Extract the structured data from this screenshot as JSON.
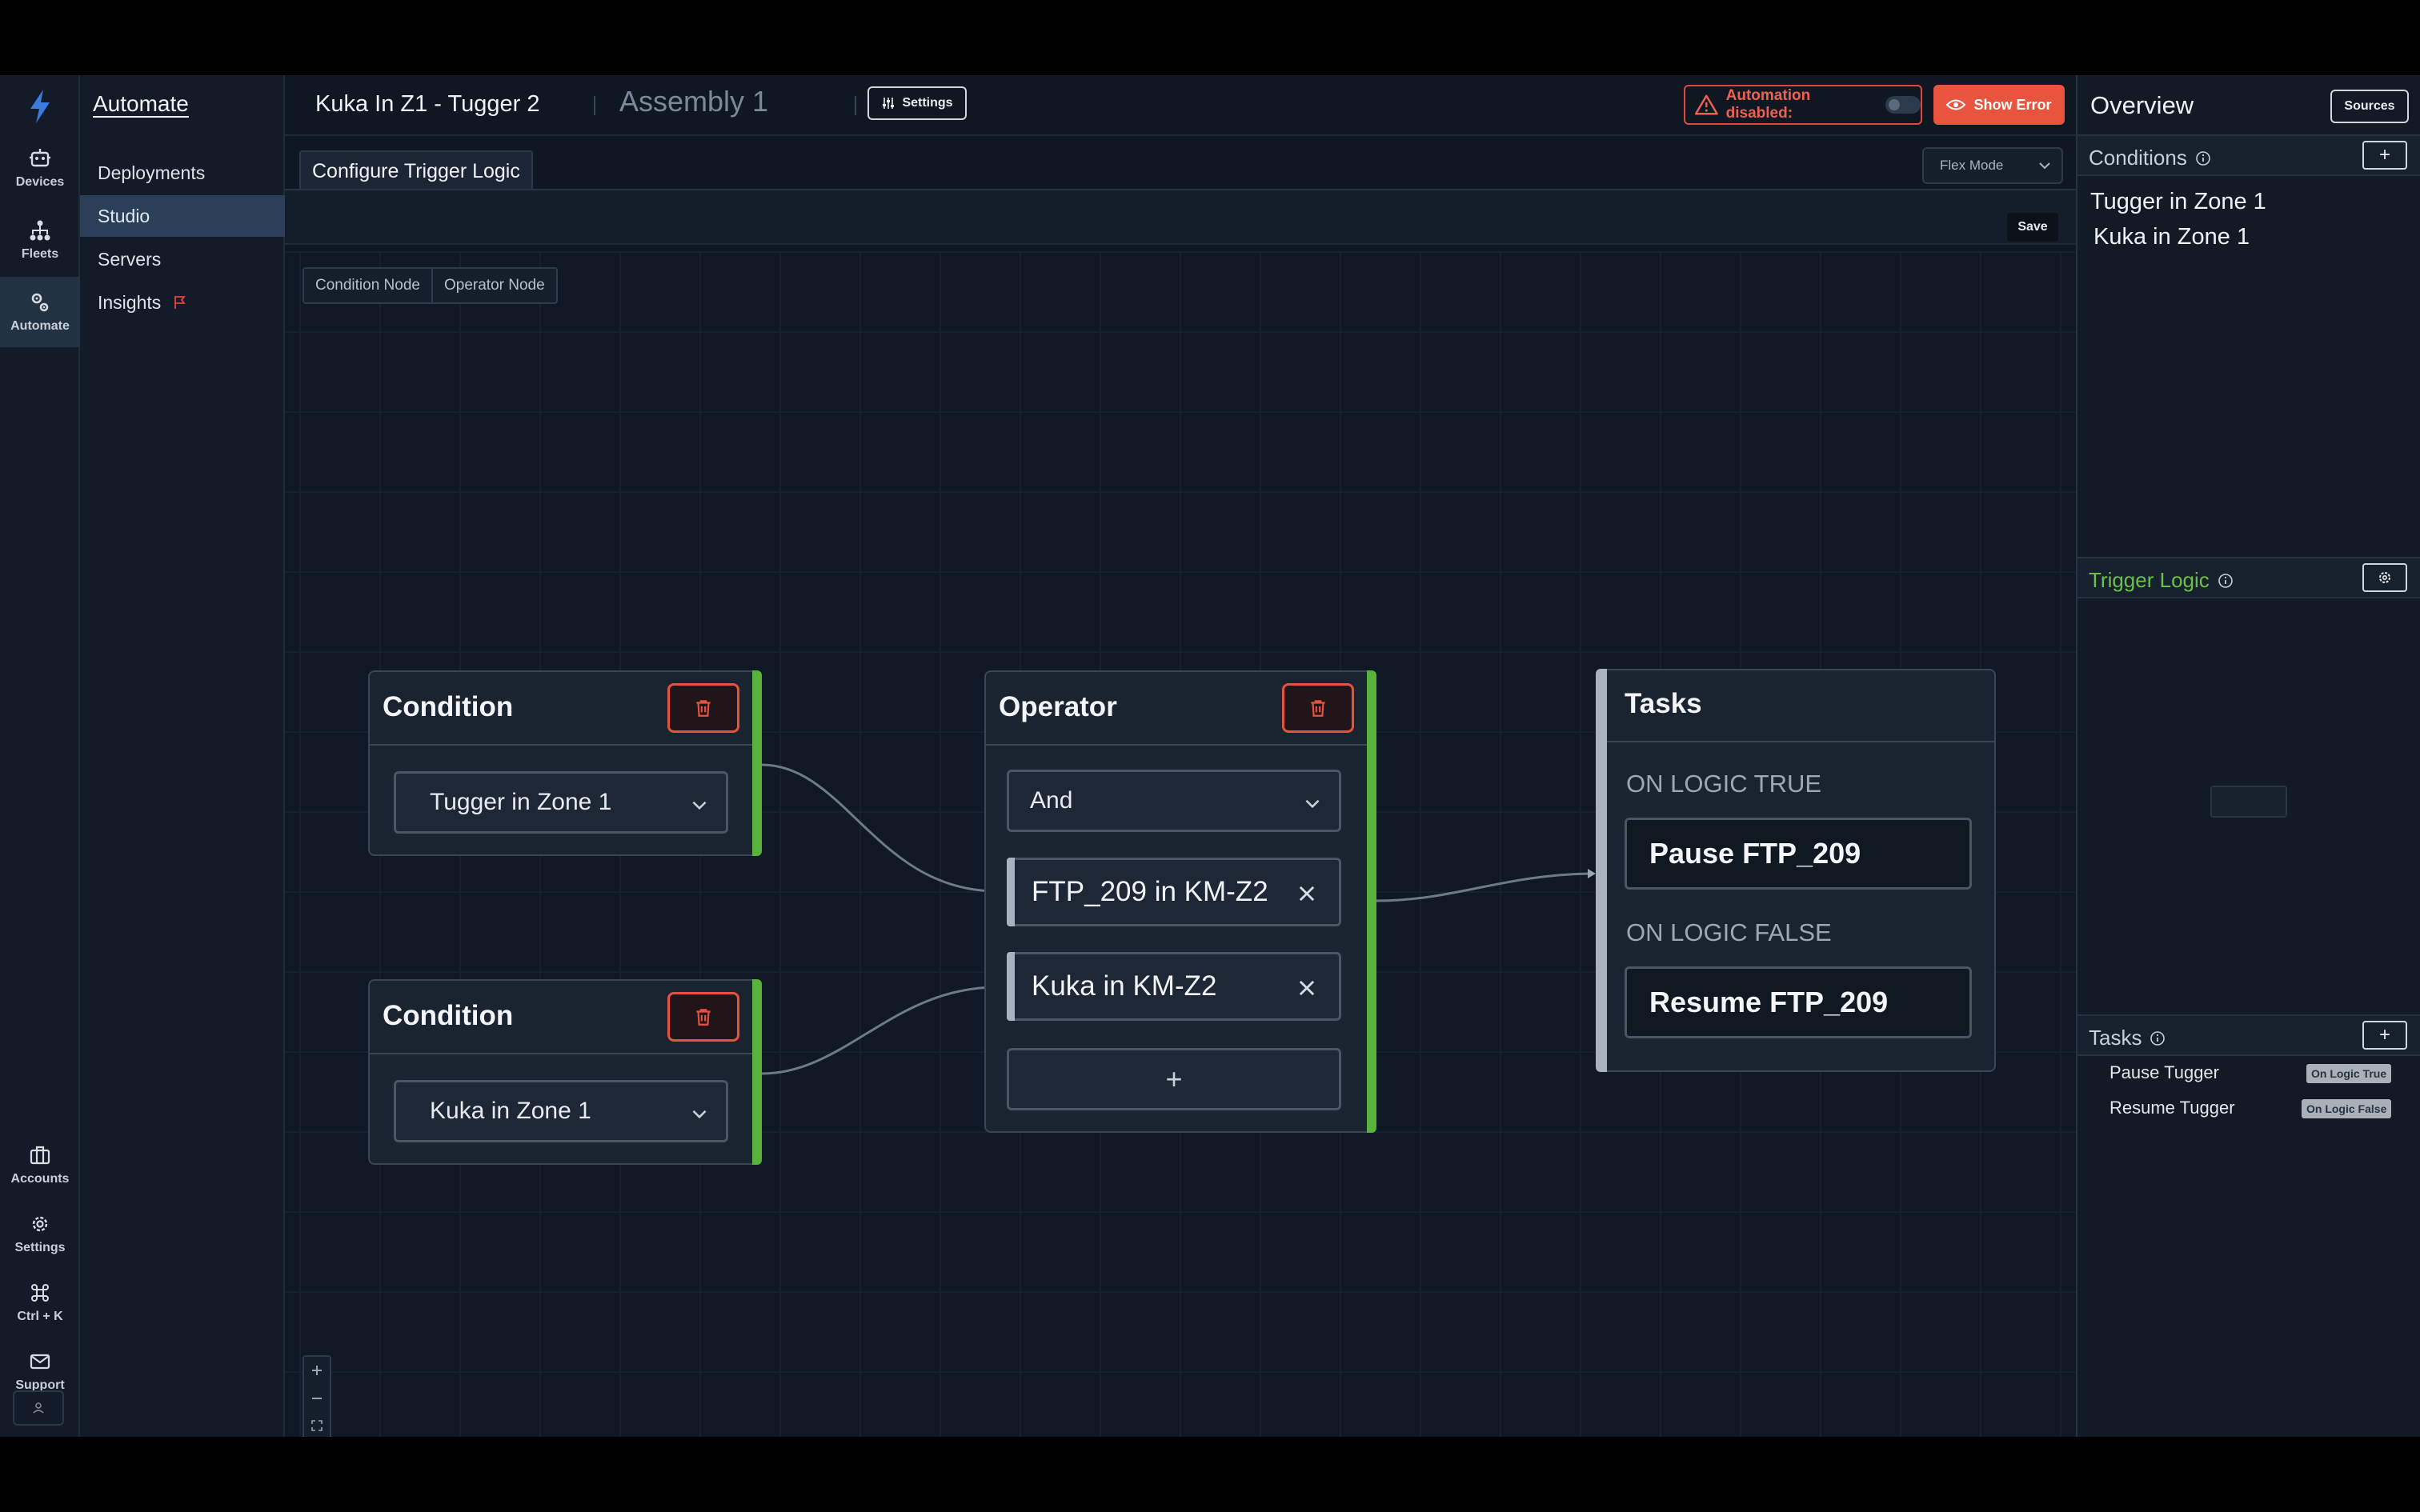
{
  "rail": {
    "items": [
      {
        "label": "Devices",
        "icon": "robot-icon"
      },
      {
        "label": "Fleets",
        "icon": "hierarchy-icon"
      },
      {
        "label": "Automate",
        "icon": "gears-icon"
      }
    ],
    "bottom_items": [
      {
        "label": "Accounts",
        "icon": "briefcase-icon"
      },
      {
        "label": "Settings",
        "icon": "gear-icon"
      },
      {
        "label": "Ctrl + K",
        "icon": "command-icon"
      },
      {
        "label": "Support",
        "icon": "mail-icon"
      }
    ]
  },
  "nav": {
    "title": "Automate",
    "items": [
      {
        "label": "Deployments"
      },
      {
        "label": "Studio"
      },
      {
        "label": "Servers"
      },
      {
        "label": "Insights"
      }
    ]
  },
  "header": {
    "title": "Kuka In Z1 - Tugger 2",
    "subtitle": "Assembly 1",
    "settings_label": "Settings",
    "alert_label": "Automation disabled:",
    "error_label": "Show Error"
  },
  "subbar": {
    "tab_label": "Configure Trigger Logic",
    "mode_label": "Flex Mode",
    "save_label": "Save"
  },
  "canvas": {
    "node_tools": [
      "Condition Node",
      "Operator Node"
    ],
    "conditions": [
      {
        "title": "Condition",
        "value": "Tugger in Zone 1"
      },
      {
        "title": "Condition",
        "value": "Kuka in Zone 1"
      }
    ],
    "operator": {
      "title": "Operator",
      "value": "And",
      "items": [
        "FTP_209 in KM-Z2",
        "Kuka in KM-Z2"
      ],
      "add_label": "+"
    },
    "tasks": {
      "title": "Tasks",
      "true_label": "ON LOGIC TRUE",
      "true_task": "Pause FTP_209",
      "false_label": "ON LOGIC FALSE",
      "false_task": "Resume FTP_209"
    },
    "accent_color": "#57b33c",
    "danger_color": "#e25340"
  },
  "right": {
    "title": "Overview",
    "sources_label": "Sources",
    "conditions_label": "Conditions",
    "conditions": [
      "Tugger in Zone 1",
      "Kuka in Zone 1"
    ],
    "trigger_label": "Trigger Logic",
    "trigger_color": "#6cc04a",
    "tasks_label": "Tasks",
    "tasks": [
      {
        "name": "Pause Tugger",
        "badge": "On Logic True"
      },
      {
        "name": "Resume Tugger",
        "badge": "On Logic False"
      }
    ]
  }
}
